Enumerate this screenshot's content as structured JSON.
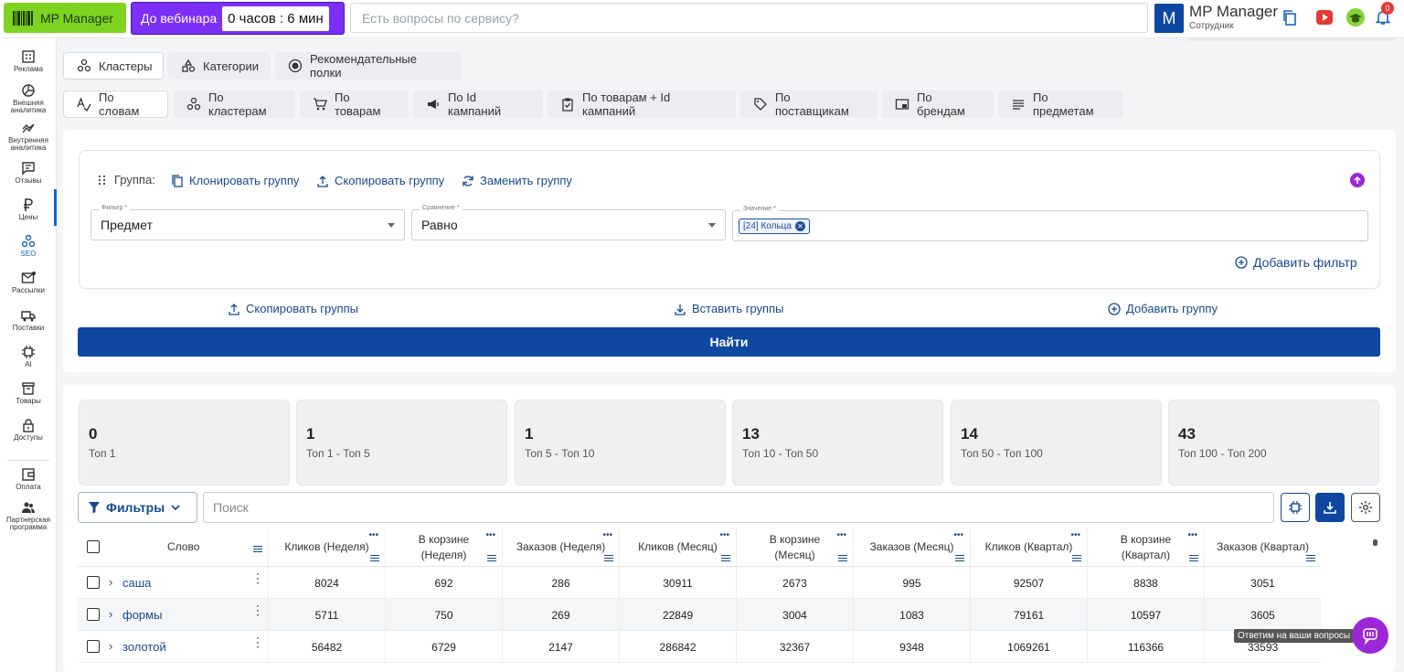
{
  "header": {
    "logo_label": "MP Manager",
    "webinar_label": "До вебинара",
    "webinar_timer": "0 часов : 6 мин",
    "ask_placeholder": "Есть вопросы по сервису?",
    "user_initial": "M",
    "user_name": "MP Manager",
    "user_role": "Сотрудник",
    "notification_count": "0"
  },
  "sidebar": {
    "items": [
      {
        "label": "Реклама",
        "icon": "ads-icon"
      },
      {
        "label": "Внешняя аналитика",
        "icon": "external-analytics-icon"
      },
      {
        "label": "Внутренняя аналитика",
        "icon": "internal-analytics-icon"
      },
      {
        "label": "Отзывы",
        "icon": "reviews-icon"
      },
      {
        "label": "Цены",
        "icon": "ruble-icon"
      },
      {
        "label": "SEO",
        "icon": "seo-icon"
      },
      {
        "label": "Рассылки",
        "icon": "mail-icon"
      },
      {
        "label": "Поставки",
        "icon": "truck-icon"
      },
      {
        "label": "AI",
        "icon": "chip-icon"
      },
      {
        "label": "Товары",
        "icon": "box-icon"
      },
      {
        "label": "Доступы",
        "icon": "lock-icon"
      },
      {
        "label": "Оплата",
        "icon": "wallet-icon"
      },
      {
        "label": "Партнерская программа",
        "icon": "partners-icon"
      }
    ]
  },
  "mode_tabs": [
    "Кластеры",
    "Категории",
    "Рекомендательные полки"
  ],
  "view_tabs": [
    "По словам",
    "По кластерам",
    "По товарам",
    "По Id кампаний",
    "По товарам + Id кампаний",
    "По поставщикам",
    "По брендам",
    "По предметам"
  ],
  "group": {
    "label": "Группа:",
    "clone": "Клонировать группу",
    "copy": "Скопировать группу",
    "replace": "Заменить группу",
    "filter_legend": "Фильтр *",
    "filter_value": "Предмет",
    "compare_legend": "Сравнение *",
    "compare_value": "Равно",
    "value_legend": "Значение *",
    "value_tag": "[24] Кольца",
    "add_filter": "Добавить фильтр"
  },
  "groups_actions": {
    "copy_groups": "Скопировать группы",
    "paste_groups": "Вставить группы",
    "add_group": "Добавить группу",
    "find": "Найти"
  },
  "stats": [
    {
      "value": "0",
      "label": "Топ 1"
    },
    {
      "value": "1",
      "label": "Топ 1 - Топ 5"
    },
    {
      "value": "1",
      "label": "Топ 5 - Топ 10"
    },
    {
      "value": "13",
      "label": "Топ 10 - Топ 50"
    },
    {
      "value": "14",
      "label": "Топ 50 - Топ 100"
    },
    {
      "value": "43",
      "label": "Топ 100 - Топ 200"
    }
  ],
  "toolbar": {
    "filters_label": "Фильтры",
    "search_placeholder": "Поиск"
  },
  "table": {
    "columns": [
      "Слово",
      "Кликов (Неделя)",
      "В корзине (Неделя)",
      "Заказов (Неделя)",
      "Кликов (Месяц)",
      "В корзине (Месяц)",
      "Заказов (Месяц)",
      "Кликов (Квартал)",
      "В корзине (Квартал)",
      "Заказов (Квартал)"
    ],
    "rows": [
      {
        "word": "саша",
        "values": [
          "8024",
          "692",
          "286",
          "30911",
          "2673",
          "995",
          "92507",
          "8838",
          "3051"
        ]
      },
      {
        "word": "формы",
        "values": [
          "5711",
          "750",
          "269",
          "22849",
          "3004",
          "1083",
          "79161",
          "10597",
          "3605"
        ]
      },
      {
        "word": "золотой",
        "values": [
          "56482",
          "6729",
          "2147",
          "286842",
          "32367",
          "9348",
          "1069261",
          "116366",
          "33593"
        ]
      }
    ]
  },
  "chat": {
    "tooltip": "Ответим на ваши вопросы"
  }
}
